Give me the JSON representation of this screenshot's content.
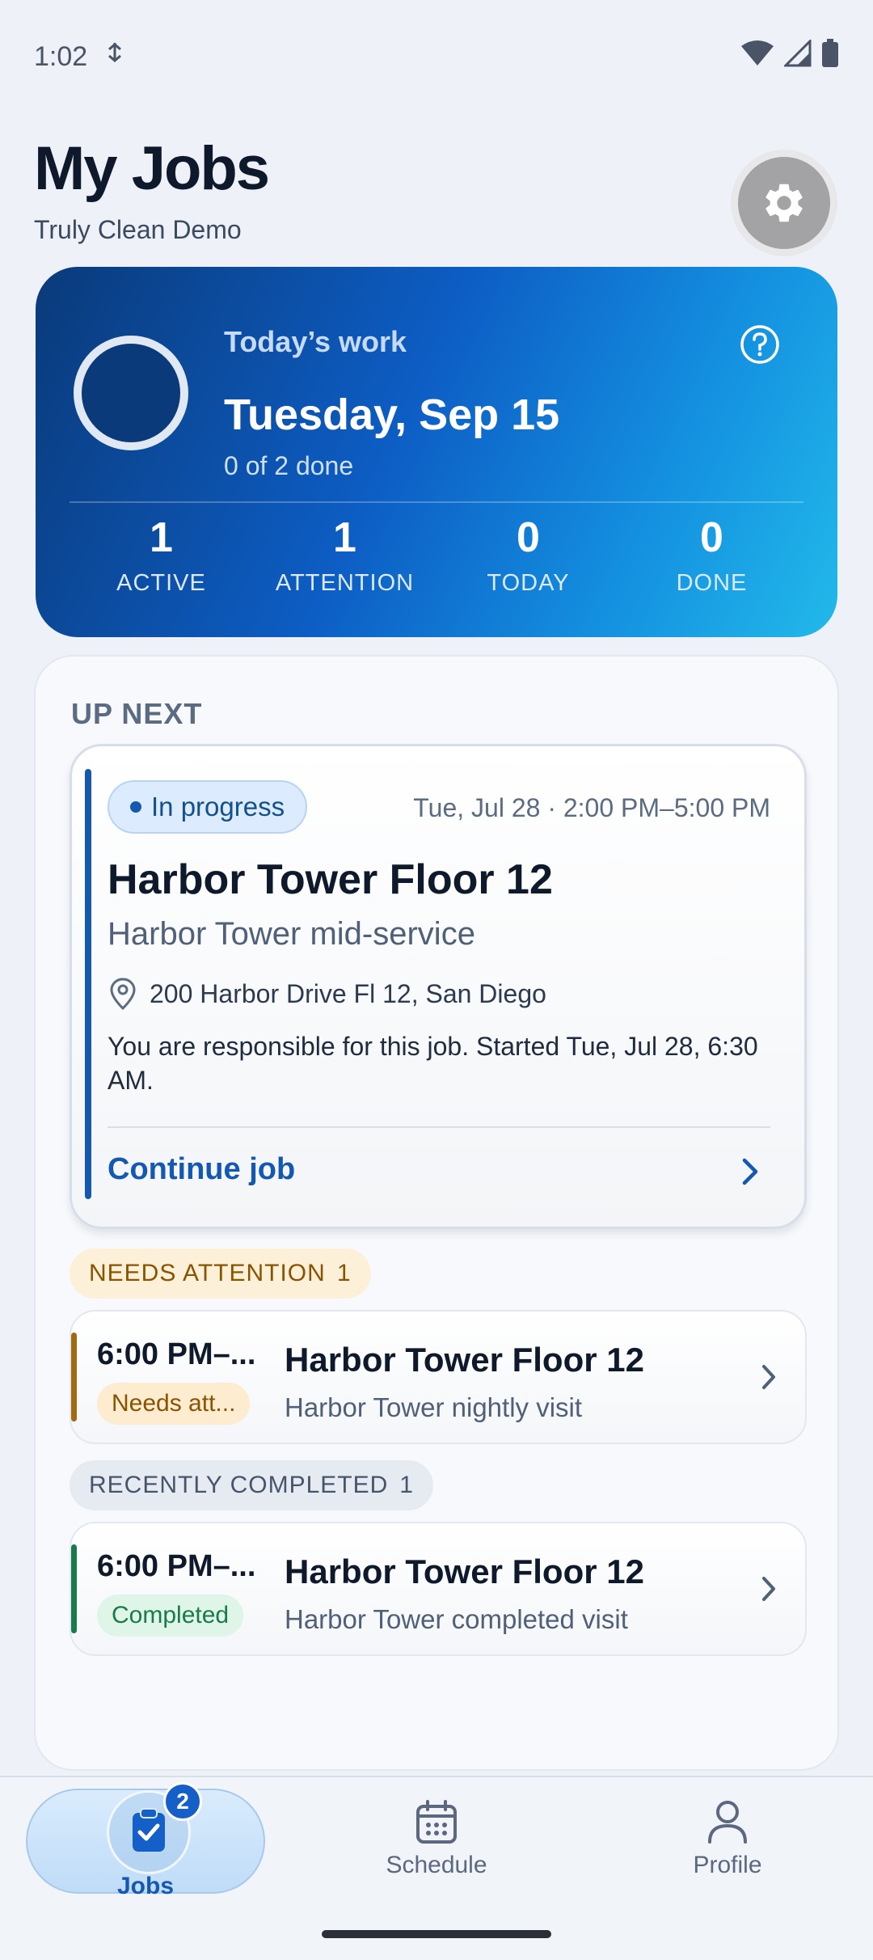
{
  "status_bar": {
    "time": "1:02"
  },
  "header": {
    "title": "My Jobs",
    "subtitle": "Truly Clean Demo"
  },
  "today": {
    "label": "Today’s work",
    "date": "Tuesday, Sep 15",
    "progress_text": "0 of 2 done",
    "progress_fraction": 0,
    "stats": [
      {
        "value": "1",
        "label": "ACTIVE"
      },
      {
        "value": "1",
        "label": "ATTENTION"
      },
      {
        "value": "0",
        "label": "TODAY"
      },
      {
        "value": "0",
        "label": "DONE"
      }
    ]
  },
  "up_next": {
    "section_title": "UP NEXT",
    "status": "In progress",
    "time": "Tue, Jul 28 · 2:00 PM–5:00 PM",
    "title": "Harbor Tower Floor 12",
    "subtitle": "Harbor Tower mid-service",
    "address": "200 Harbor Drive Fl 12, San Diego",
    "note": "You are responsible for this job. Started Tue, Jul 28, 6:30 AM.",
    "action": "Continue job"
  },
  "attention": {
    "chip_label": "NEEDS ATTENTION",
    "chip_count": "1",
    "row": {
      "time": "6:00 PM–...",
      "badge": "Needs att...",
      "title": "Harbor Tower Floor 12",
      "subtitle": "Harbor Tower nightly visit"
    }
  },
  "completed": {
    "chip_label": "RECENTLY COMPLETED",
    "chip_count": "1",
    "row": {
      "time": "6:00 PM–...",
      "badge": "Completed",
      "title": "Harbor Tower Floor 12",
      "subtitle": "Harbor Tower completed visit"
    }
  },
  "nav": {
    "items": [
      {
        "label": "Jobs",
        "icon": "clipboard-check-icon",
        "badge": "2",
        "active": true
      },
      {
        "label": "Schedule",
        "icon": "calendar-icon"
      },
      {
        "label": "Profile",
        "icon": "person-icon"
      }
    ]
  },
  "colors": {
    "accent": "#1558b0",
    "attention": "#a06a10",
    "completed": "#1a7a4c"
  }
}
